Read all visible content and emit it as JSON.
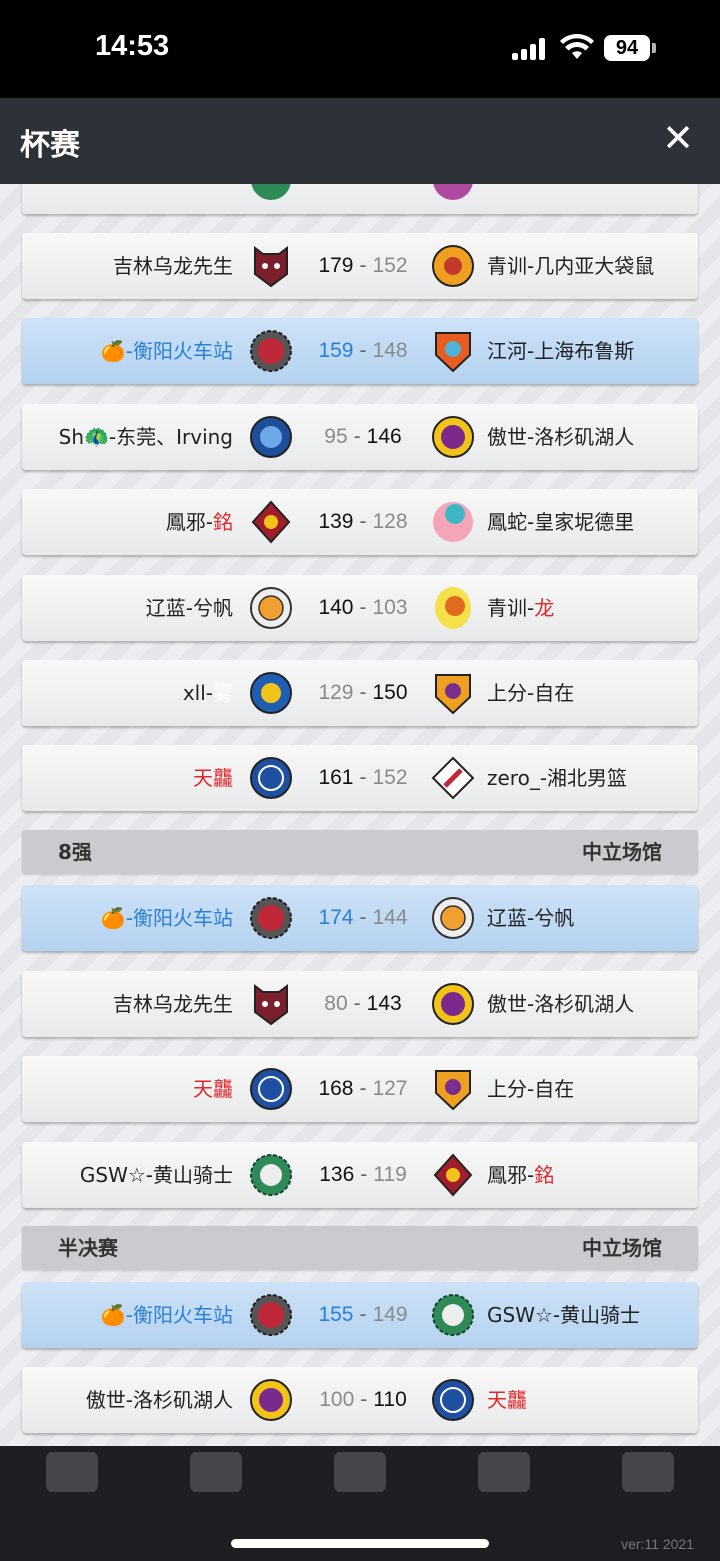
{
  "status_bar": {
    "time": "14:53",
    "battery": "94"
  },
  "header": {
    "title": "杯赛",
    "close_label": "✕"
  },
  "rounds": [
    {
      "matches": [
        {
          "home": "吉林乌龙先生",
          "home_score": "179",
          "away_score": "152",
          "away": "青训-几内亚大袋鼠"
        },
        {
          "home_prefix": "🍊",
          "home": "-衡阳火车站",
          "home_score": "159",
          "away_score": "148",
          "away": "江河-上海布鲁斯"
        },
        {
          "home": "Sh🦚-东莞、Irving",
          "home_score": "95",
          "away_score": "146",
          "away": "傲世-洛杉矶湖人"
        },
        {
          "home": "鳳邪-",
          "home_suffix": "銘",
          "home_score": "139",
          "away_score": "128",
          "away": "鳳蛇-皇家坭德里"
        },
        {
          "home": "辽蓝-兮帆",
          "home_score": "140",
          "away_score": "103",
          "away": "青训-",
          "away_suffix": "龙"
        },
        {
          "home": "xll-",
          "home_suffix": "雾",
          "home_score": "129",
          "away_score": "150",
          "away": "上分-自在"
        },
        {
          "home": "天龘",
          "home_score": "161",
          "away_score": "152",
          "away": "zero_-湘北男篮"
        }
      ]
    },
    {
      "label": "8强",
      "venue": "中立场馆",
      "matches": [
        {
          "home_prefix": "🍊",
          "home": "-衡阳火车站",
          "home_score": "174",
          "away_score": "144",
          "away": "辽蓝-兮帆"
        },
        {
          "home": "吉林乌龙先生",
          "home_score": "80",
          "away_score": "143",
          "away": "傲世-洛杉矶湖人"
        },
        {
          "home": "天龘",
          "home_score": "168",
          "away_score": "127",
          "away": "上分-自在"
        },
        {
          "home": "GSW☆-黄山骑士",
          "home_score": "136",
          "away_score": "119",
          "away": "鳳邪-",
          "away_suffix": "銘"
        }
      ]
    },
    {
      "label": "半决赛",
      "venue": "中立场馆",
      "matches": [
        {
          "home_prefix": "🍊",
          "home": "-衡阳火车站",
          "home_score": "155",
          "away_score": "149",
          "away": "GSW☆-黄山骑士"
        },
        {
          "home": "傲世-洛杉矶湖人",
          "home_score": "100",
          "away_score": "110",
          "away": "天龘"
        }
      ]
    }
  ],
  "footer": {
    "version": "ver:11 2021"
  },
  "colors": {
    "highlight_blue": "#2a7fd6",
    "red_name": "#e0282a",
    "header_bg": "#2d3138"
  }
}
